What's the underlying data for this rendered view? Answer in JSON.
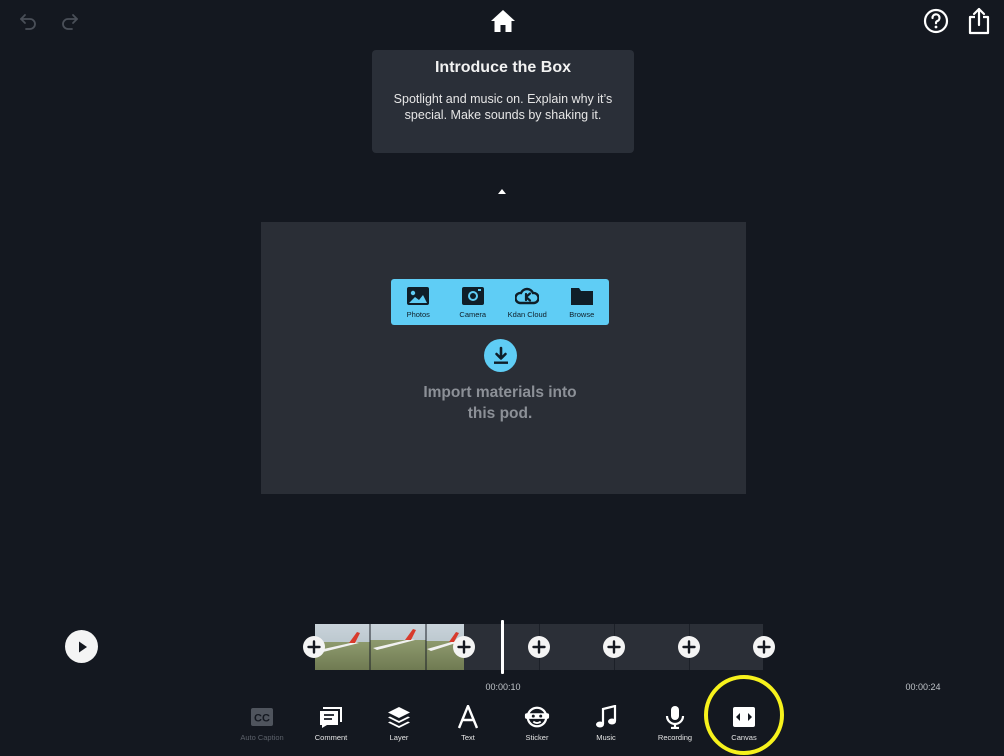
{
  "scene": {
    "title": "Introduce the Box",
    "description": "Spotlight and music on. Explain why it’s special. Make sounds by shaking it."
  },
  "import": {
    "sources": [
      {
        "label": "Photos",
        "icon": "photos-icon"
      },
      {
        "label": "Camera",
        "icon": "camera-icon"
      },
      {
        "label": "Kdan Cloud",
        "icon": "kdan-cloud-icon"
      },
      {
        "label": "Browse",
        "icon": "folder-icon"
      }
    ],
    "message_line1": "Import materials into",
    "message_line2": "this pod."
  },
  "timeline": {
    "current_time": "00:00:10",
    "total_time": "00:00:24"
  },
  "toolbar": {
    "auto_caption": "Auto Caption",
    "comment": "Comment",
    "layer": "Layer",
    "text": "Text",
    "sticker": "Sticker",
    "music": "Music",
    "recording": "Recording",
    "canvas": "Canvas"
  },
  "colors": {
    "background": "#141820",
    "accent": "#5fcdf5",
    "highlight": "#f7f21c"
  }
}
